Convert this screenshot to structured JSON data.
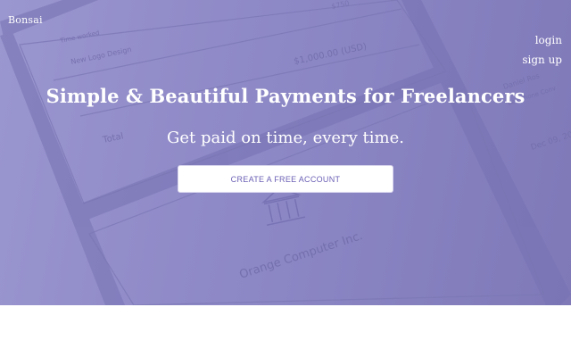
{
  "brand": {
    "name": "Bonsai"
  },
  "nav": {
    "login": "login",
    "signup": "sign up"
  },
  "hero": {
    "headline": "Simple & Beautiful Payments for Freelancers",
    "subheadline": "Get paid on time, every time.",
    "cta_label": "CREATE A FREE ACCOUNT"
  },
  "background_invoice": {
    "line_item": "New Logo Design",
    "line_label": "Time worked",
    "amount": "$1,000.00 (USD)",
    "amount_top": "$750",
    "total_label": "Total",
    "client_name": "Orange Computer Inc.",
    "from_name": "Daniel Ros",
    "from_detail": "Lee Phone Conv",
    "date": "Dec 09, 20"
  },
  "colors": {
    "hero_overlay": "#8d88c6",
    "cta_text": "#6a5fb5",
    "cta_background": "#ffffff"
  }
}
